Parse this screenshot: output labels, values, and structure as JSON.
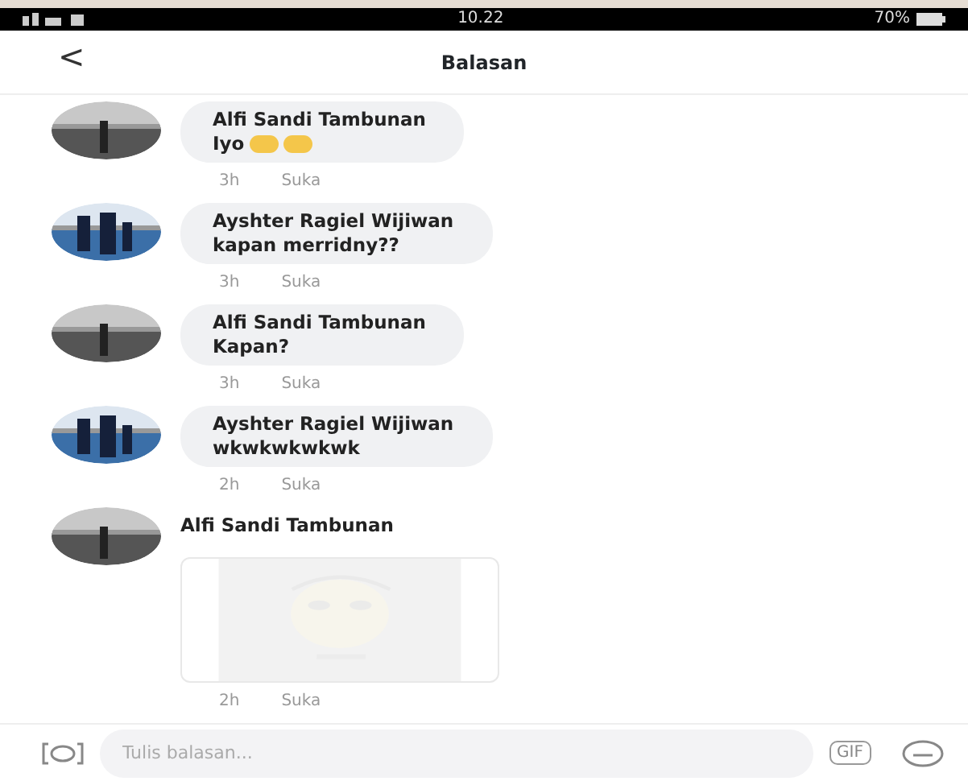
{
  "status_bar": {
    "time": "10.22",
    "battery": "70%"
  },
  "header": {
    "back": "<",
    "title": "Balasan"
  },
  "comments": [
    {
      "author": "Alfi Sandi Tambunan",
      "text": "Iyo",
      "emojis": [
        {
          "kind": "laugh"
        },
        {
          "kind": "laugh"
        }
      ],
      "time": "3h",
      "like": "Suka",
      "kind": "text"
    },
    {
      "author": "Ayshter Ragiel Wijiwan",
      "text": "kapan merridny??",
      "time": "3h",
      "like": "Suka",
      "kind": "text"
    },
    {
      "author": "Alfi Sandi Tambunan",
      "text": "Kapan?",
      "time": "3h",
      "like": "Suka",
      "kind": "text"
    },
    {
      "author": "Ayshter Ragiel Wijiwan",
      "text": "wkwkwkwkwk",
      "time": "2h",
      "like": "Suka",
      "kind": "text"
    },
    {
      "author": "Alfi Sandi Tambunan",
      "time": "2h",
      "like": "Suka",
      "kind": "sticker"
    }
  ],
  "composer": {
    "placeholder": "Tulis balasan...",
    "gif": "GIF"
  }
}
